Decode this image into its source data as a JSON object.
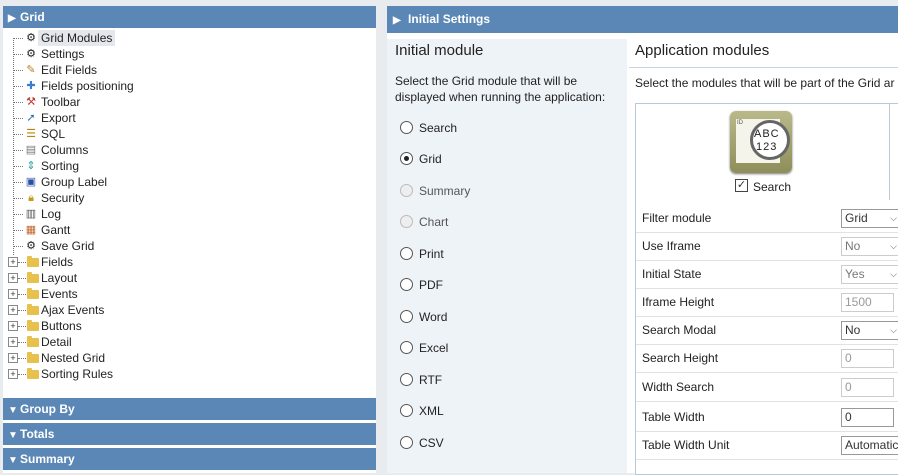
{
  "left": {
    "header_title": "Grid",
    "tree": [
      {
        "label": "Grid Modules",
        "icon": "gear-icon",
        "selected": true
      },
      {
        "label": "Settings",
        "icon": "gear-icon"
      },
      {
        "label": "Edit Fields",
        "icon": "pencil-icon"
      },
      {
        "label": "Fields positioning",
        "icon": "move-icon"
      },
      {
        "label": "Toolbar",
        "icon": "tools-icon"
      },
      {
        "label": "Export",
        "icon": "export-arrow-icon"
      },
      {
        "label": "SQL",
        "icon": "database-icon"
      },
      {
        "label": "Columns",
        "icon": "columns-icon"
      },
      {
        "label": "Sorting",
        "icon": "sort-arrows-icon"
      },
      {
        "label": "Group Label",
        "icon": "group-label-icon"
      },
      {
        "label": "Security",
        "icon": "lock-icon"
      },
      {
        "label": "Log",
        "icon": "log-icon"
      },
      {
        "label": "Gantt",
        "icon": "gantt-icon"
      },
      {
        "label": "Save Grid",
        "icon": "gear-icon"
      }
    ],
    "folders": [
      "Fields",
      "Layout",
      "Events",
      "Ajax Events",
      "Buttons",
      "Detail",
      "Nested Grid",
      "Sorting Rules"
    ],
    "bottom_panels": [
      "Group By",
      "Totals",
      "Summary"
    ]
  },
  "right": {
    "header_title": "Initial Settings",
    "initial_module": {
      "title": "Initial module",
      "description_line1": "Select the Grid module that will be",
      "description_line2": "displayed when running the application:",
      "options": [
        {
          "label": "Search",
          "state": "enabled"
        },
        {
          "label": "Grid",
          "state": "checked"
        },
        {
          "label": "Summary",
          "state": "disabled"
        },
        {
          "label": "Chart",
          "state": "disabled"
        },
        {
          "label": "Print",
          "state": "enabled"
        },
        {
          "label": "PDF",
          "state": "enabled"
        },
        {
          "label": "Word",
          "state": "enabled"
        },
        {
          "label": "Excel",
          "state": "enabled"
        },
        {
          "label": "RTF",
          "state": "enabled"
        },
        {
          "label": "XML",
          "state": "enabled"
        },
        {
          "label": "CSV",
          "state": "enabled"
        }
      ]
    },
    "app_modules": {
      "title": "Application modules",
      "description": "Select the modules that will be part of the Grid ar",
      "search_module_label": "Search",
      "search_icon_text_line1": "ABC",
      "search_icon_text_line2": "123",
      "search_icon_tag": "ID",
      "properties": [
        {
          "label": "Filter module",
          "kind": "select",
          "value": "Grid",
          "disabled": false
        },
        {
          "label": "Use Iframe",
          "kind": "select",
          "value": "No",
          "disabled": true
        },
        {
          "label": "Initial State",
          "kind": "select",
          "value": "Yes",
          "disabled": true
        },
        {
          "label": "Iframe Height",
          "kind": "text",
          "value": "1500",
          "disabled": true
        },
        {
          "label": "Search Modal",
          "kind": "select",
          "value": "No",
          "disabled": false
        },
        {
          "label": "Search Height",
          "kind": "text",
          "value": "0",
          "disabled": true
        },
        {
          "label": "Width Search",
          "kind": "text",
          "value": "0",
          "disabled": true
        },
        {
          "label": "Table Width",
          "kind": "text",
          "value": "0",
          "disabled": false
        },
        {
          "label": "Table Width Unit",
          "kind": "select",
          "value": "Automatic",
          "disabled": false
        }
      ]
    }
  },
  "colors": {
    "header_blue": "#5b87b6",
    "col_bg": "#eef3f8"
  }
}
